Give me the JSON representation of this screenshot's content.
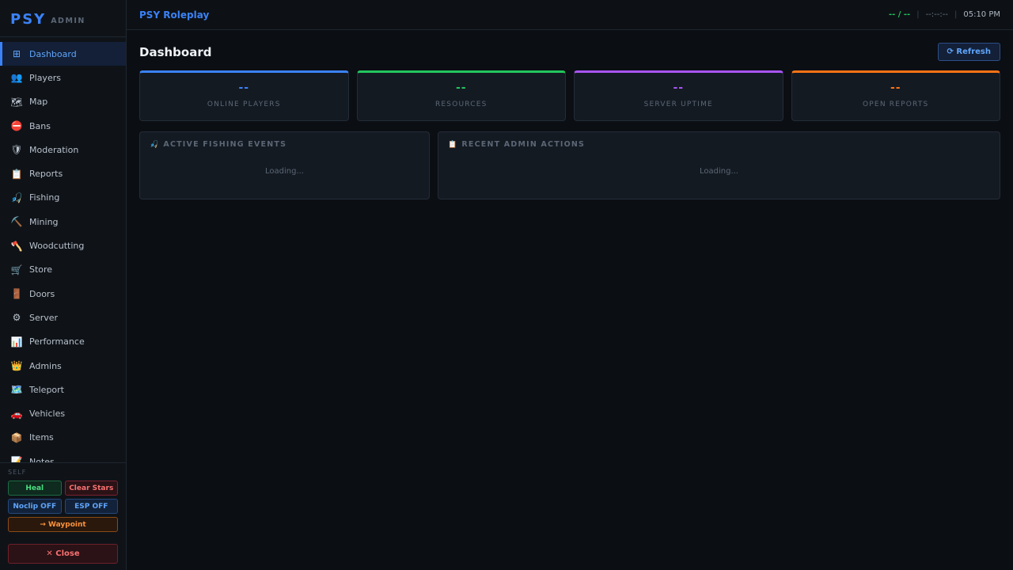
{
  "brand": {
    "main": "PSY",
    "sub": "ADMIN"
  },
  "nav": [
    {
      "label": "Dashboard",
      "icon": "⊞",
      "icon_name": "grid-icon",
      "active": true
    },
    {
      "label": "Players",
      "icon": "👥",
      "icon_name": "users-icon"
    },
    {
      "label": "Map",
      "icon": "🗺",
      "icon_name": "map-icon"
    },
    {
      "label": "Bans",
      "icon": "⛔",
      "icon_name": "no-entry-icon"
    },
    {
      "label": "Moderation",
      "icon": "🛡",
      "icon_name": "shield-icon"
    },
    {
      "label": "Reports",
      "icon": "📋",
      "icon_name": "clipboard-icon"
    },
    {
      "label": "Fishing",
      "icon": "🎣",
      "icon_name": "fishing-rod-icon"
    },
    {
      "label": "Mining",
      "icon": "⛏️",
      "icon_name": "pickaxe-icon"
    },
    {
      "label": "Woodcutting",
      "icon": "🪓",
      "icon_name": "axe-icon"
    },
    {
      "label": "Store",
      "icon": "🛒",
      "icon_name": "cart-icon"
    },
    {
      "label": "Doors",
      "icon": "🚪",
      "icon_name": "door-icon"
    },
    {
      "label": "Server",
      "icon": "⚙",
      "icon_name": "gear-icon"
    },
    {
      "label": "Performance",
      "icon": "📊",
      "icon_name": "bar-chart-icon"
    },
    {
      "label": "Admins",
      "icon": "👑",
      "icon_name": "crown-icon"
    },
    {
      "label": "Teleport",
      "icon": "🗺️",
      "icon_name": "teleport-map-icon"
    },
    {
      "label": "Vehicles",
      "icon": "🚗",
      "icon_name": "car-icon"
    },
    {
      "label": "Items",
      "icon": "📦",
      "icon_name": "package-icon"
    },
    {
      "label": "Notes",
      "icon": "📝",
      "icon_name": "memo-icon"
    }
  ],
  "self": {
    "title": "SELF",
    "heal": "Heal",
    "clear_stars": "Clear Stars",
    "noclip": "Noclip OFF",
    "esp": "ESP OFF",
    "waypoint": "→ Waypoint",
    "close": "✕ Close"
  },
  "topbar": {
    "server_name": "PSY Roleplay",
    "players": "-- / --",
    "uptime": "--:--:--",
    "separator": "|",
    "time": "05:10 PM"
  },
  "page": {
    "title": "Dashboard",
    "refresh": "⟳ Refresh"
  },
  "stats": [
    {
      "value": "--",
      "label": "ONLINE PLAYERS",
      "color": "#3b82f6"
    },
    {
      "value": "--",
      "label": "RESOURCES",
      "color": "#22c55e"
    },
    {
      "value": "--",
      "label": "SERVER UPTIME",
      "color": "#a855f7"
    },
    {
      "value": "--",
      "label": "OPEN REPORTS",
      "color": "#f97316"
    }
  ],
  "panels": {
    "fishing": {
      "icon": "🎣",
      "title": "ACTIVE FISHING EVENTS",
      "body": "Loading..."
    },
    "actions": {
      "icon": "📋",
      "title": "RECENT ADMIN ACTIONS",
      "body": "Loading..."
    }
  }
}
